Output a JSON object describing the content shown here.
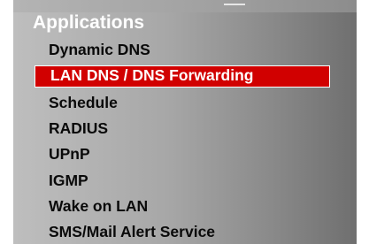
{
  "menu": {
    "title": "Applications",
    "items": [
      {
        "label": "Dynamic DNS",
        "selected": false
      },
      {
        "label": "LAN DNS / DNS Forwarding",
        "selected": true
      },
      {
        "label": "Schedule",
        "selected": false
      },
      {
        "label": "RADIUS",
        "selected": false
      },
      {
        "label": "UPnP",
        "selected": false
      },
      {
        "label": "IGMP",
        "selected": false
      },
      {
        "label": "Wake on LAN",
        "selected": false
      },
      {
        "label": "SMS/Mail Alert Service",
        "selected": false
      }
    ],
    "colors": {
      "title_text": "#ffffff",
      "item_text": "#0a0a0a",
      "selected_bg": "#d10000",
      "selected_text": "#ffffff"
    }
  }
}
